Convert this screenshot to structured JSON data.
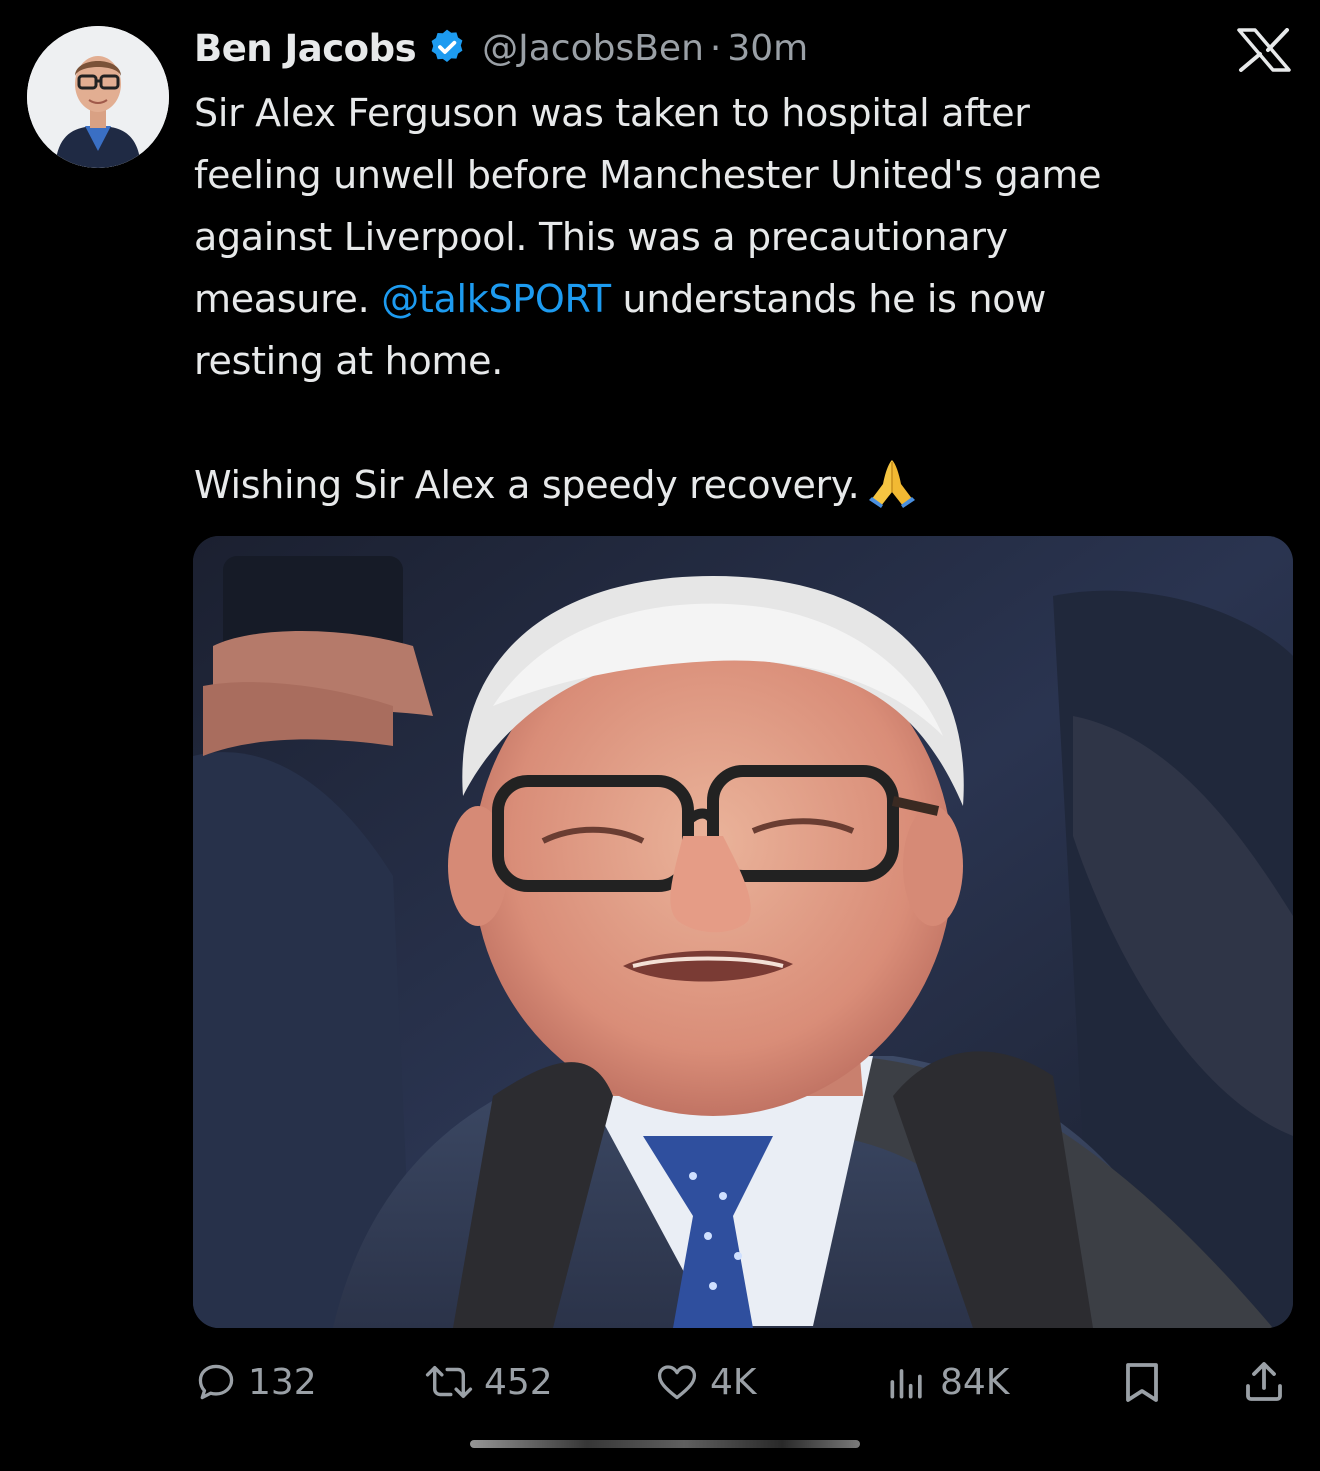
{
  "author": {
    "name": "Ben Jacobs",
    "handle": "@JacobsBen",
    "separator": "·",
    "time": "30m",
    "verified": true
  },
  "tweet": {
    "line1": "Sir Alex Ferguson was taken to hospital after",
    "line2": "feeling unwell before Manchester United's game",
    "line3": "against Liverpool. This was a precautionary",
    "line4_pre": "measure. ",
    "mention": "@talkSPORT",
    "line4_post": " understands he is now",
    "line5": "resting at home.",
    "line6": "Wishing Sir Alex a speedy recovery.",
    "emoji": "folded-hands"
  },
  "actions": {
    "replies": "132",
    "reposts": "452",
    "likes": "4K",
    "views": "84K"
  },
  "colors": {
    "background": "#000000",
    "text": "#e7e9ea",
    "muted": "#9aa0a6",
    "accent": "#1d9bf0"
  }
}
